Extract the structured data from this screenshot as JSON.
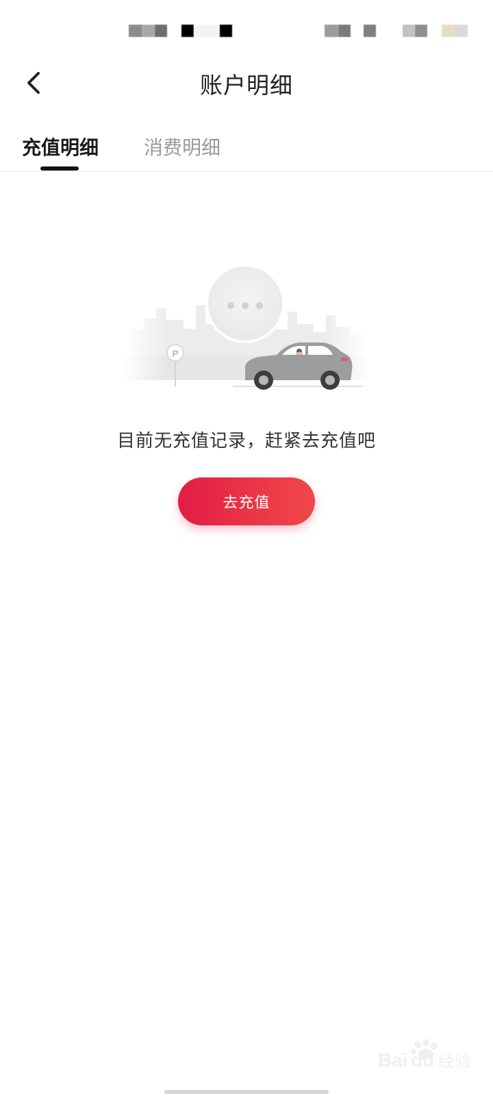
{
  "header": {
    "title": "账户明细",
    "back_icon": "chevron-left-icon"
  },
  "tabs": [
    {
      "label": "充值明细",
      "active": true
    },
    {
      "label": "消费明细",
      "active": false
    }
  ],
  "empty_state": {
    "illustration": "parked-car-illustration",
    "message": "目前无充值记录，赶紧去充值吧",
    "button_label": "去充值"
  },
  "colors": {
    "accent_start": "#e31d45",
    "accent_end": "#f04848",
    "tab_active": "#1a1a1a",
    "tab_inactive": "#999999"
  }
}
